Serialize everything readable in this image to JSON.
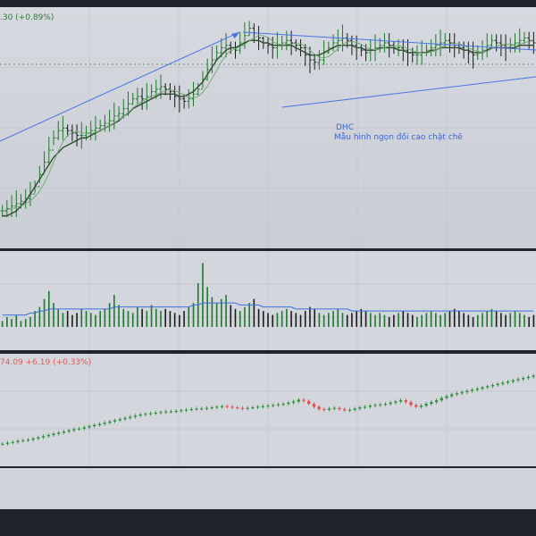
{
  "price_legend_text": ".30 (+0.89%)",
  "index_legend_text": "74.09 +6.19 (+0.33%)",
  "annotation": {
    "ticker": "DHC",
    "pattern": "Mẫu hình ngọn đồi cao chặt chẽ"
  },
  "colors": {
    "up": "#1e7a2a",
    "down": "#1c1c1c",
    "ma_long": "#2f4f2f",
    "ma_short": "#6aa86a",
    "trendline": "#4a73e8",
    "volume_ma": "#3b6fe0",
    "index_up": "#2e8b3a",
    "index_down": "#e04b4b"
  },
  "chart_data": [
    {
      "type": "ohlc",
      "panel": "price",
      "grid": true,
      "series": [
        {
          "name": "price",
          "values": [
            18.6,
            18.7,
            18.8,
            18.9,
            19.0,
            19.1,
            19.3,
            19.6,
            20.1,
            20.6,
            21.1,
            21.6,
            21.9,
            22.0,
            21.9,
            21.8,
            21.7,
            21.7,
            21.8,
            21.9,
            22.0,
            22.1,
            22.2,
            22.3,
            22.5,
            22.6,
            22.8,
            23.0,
            23.2,
            23.3,
            23.2,
            23.3,
            23.5,
            23.6,
            23.7,
            23.6,
            23.5,
            23.3,
            23.2,
            23.1,
            23.2,
            23.4,
            23.6,
            24.0,
            24.4,
            24.8,
            25.1,
            25.3,
            25.4,
            25.3,
            25.2,
            25.5,
            25.8,
            26.1,
            25.9,
            25.7,
            25.5,
            25.4,
            25.3,
            25.4,
            25.5,
            25.6,
            25.5,
            25.4,
            25.3,
            25.0,
            24.8,
            24.7,
            24.8,
            25.1,
            25.3,
            25.5,
            25.6,
            25.7,
            25.6,
            25.4,
            25.3,
            25.2,
            25.1,
            25.2,
            25.3,
            25.4,
            25.5,
            25.4,
            25.3,
            25.3,
            25.2,
            25.1,
            25.0,
            25.0,
            25.1,
            25.2,
            25.3,
            25.4,
            25.5,
            25.6,
            25.5,
            25.4,
            25.3,
            25.2,
            25.1,
            25.0,
            25.1,
            25.2,
            25.4,
            25.6,
            25.5,
            25.4,
            25.3,
            25.4,
            25.5,
            25.6,
            25.7,
            25.6,
            25.5
          ]
        },
        {
          "name": "ma_long",
          "values": [
            18.4,
            18.4,
            18.5,
            18.6,
            18.8,
            19.0,
            19.3,
            19.6,
            19.9,
            20.2,
            20.5,
            20.8,
            21.0,
            21.2,
            21.3,
            21.4,
            21.5,
            21.6,
            21.6,
            21.7,
            21.8,
            21.9,
            22.0,
            22.1,
            22.2,
            22.3,
            22.5,
            22.6,
            22.8,
            22.9,
            23.0,
            23.1,
            23.2,
            23.3,
            23.4,
            23.4,
            23.4,
            23.4,
            23.3,
            23.3,
            23.4,
            23.5,
            23.7,
            23.9,
            24.2,
            24.5,
            24.8,
            25.0,
            25.2,
            25.3,
            25.3,
            25.4,
            25.5,
            25.6,
            25.6,
            25.6,
            25.5,
            25.5,
            25.4,
            25.4,
            25.4,
            25.4,
            25.4,
            25.3,
            25.2,
            25.1,
            25.0,
            25.0,
            25.0,
            25.1,
            25.2,
            25.3,
            25.4,
            25.4,
            25.4,
            25.4,
            25.3,
            25.3,
            25.2,
            25.2,
            25.2,
            25.3,
            25.3,
            25.3,
            25.3,
            25.2,
            25.2,
            25.1,
            25.1,
            25.1,
            25.1,
            25.1,
            25.2,
            25.2,
            25.3,
            25.3,
            25.3,
            25.3,
            25.3,
            25.2,
            25.2,
            25.1,
            25.1,
            25.1,
            25.2,
            25.3,
            25.3,
            25.3,
            25.3,
            25.3,
            25.3,
            25.4,
            25.4,
            25.4,
            25.4
          ]
        }
      ]
    },
    {
      "type": "bar",
      "panel": "volume",
      "series": [
        {
          "name": "volume",
          "values": [
            3,
            5,
            4,
            6,
            3,
            4,
            5,
            8,
            10,
            14,
            18,
            12,
            9,
            7,
            8,
            6,
            7,
            9,
            8,
            7,
            6,
            8,
            9,
            12,
            16,
            11,
            9,
            8,
            7,
            10,
            9,
            8,
            11,
            9,
            8,
            9,
            8,
            7,
            6,
            8,
            10,
            12,
            22,
            32,
            20,
            15,
            12,
            14,
            16,
            11,
            9,
            8,
            10,
            12,
            14,
            9,
            8,
            7,
            6,
            7,
            8,
            9,
            8,
            7,
            6,
            8,
            10,
            9,
            7,
            6,
            7,
            8,
            9,
            7,
            6,
            7,
            8,
            9,
            8,
            7,
            6,
            7,
            6,
            5,
            6,
            7,
            8,
            7,
            6,
            5,
            6,
            7,
            8,
            7,
            6,
            7,
            8,
            9,
            8,
            7,
            6,
            5,
            6,
            7,
            8,
            9,
            8,
            7,
            6,
            7,
            8,
            7,
            6,
            5,
            6
          ]
        },
        {
          "name": "volume_ma",
          "values": [
            6,
            6,
            6,
            6,
            6,
            6,
            7,
            7,
            8,
            8,
            9,
            9,
            9,
            9,
            9,
            9,
            9,
            9,
            9,
            9,
            9,
            9,
            9,
            9,
            10,
            10,
            10,
            10,
            10,
            10,
            10,
            10,
            10,
            10,
            10,
            10,
            10,
            10,
            10,
            10,
            10,
            11,
            11,
            12,
            12,
            12,
            12,
            12,
            12,
            12,
            12,
            11,
            11,
            11,
            11,
            11,
            10,
            10,
            10,
            10,
            10,
            10,
            10,
            9,
            9,
            9,
            9,
            9,
            9,
            9,
            9,
            9,
            9,
            9,
            9,
            8,
            8,
            8,
            8,
            8,
            8,
            8,
            8,
            8,
            8,
            8,
            8,
            8,
            8,
            8,
            8,
            8,
            8,
            8,
            8,
            8,
            8,
            8,
            8,
            8,
            8,
            8,
            8,
            8,
            8,
            8,
            8,
            8,
            8,
            8,
            8,
            8,
            8,
            8,
            8
          ]
        }
      ]
    },
    {
      "type": "candlestick",
      "panel": "index",
      "series": [
        {
          "name": "index",
          "values": [
            1440,
            1442,
            1443,
            1445,
            1446,
            1447,
            1449,
            1451,
            1453,
            1455,
            1457,
            1459,
            1461,
            1463,
            1465,
            1466,
            1468,
            1470,
            1472,
            1474,
            1476,
            1478,
            1480,
            1482,
            1484,
            1486,
            1488,
            1490,
            1491,
            1492,
            1493,
            1494,
            1495,
            1495,
            1496,
            1497,
            1498,
            1499,
            1500,
            1500,
            1501,
            1502,
            1503,
            1504,
            1503,
            1502,
            1501,
            1500,
            1501,
            1502,
            1503,
            1504,
            1505,
            1506,
            1507,
            1508,
            1510,
            1512,
            1515,
            1513,
            1508,
            1503,
            1499,
            1498,
            1500,
            1501,
            1499,
            1497,
            1498,
            1500,
            1502,
            1503,
            1505,
            1506,
            1507,
            1508,
            1510,
            1512,
            1514,
            1511,
            1506,
            1503,
            1505,
            1508,
            1511,
            1514,
            1518,
            1521,
            1524,
            1526,
            1528,
            1530,
            1532,
            1534,
            1536,
            1538,
            1540,
            1542,
            1544,
            1546,
            1548,
            1550,
            1552,
            1554,
            1556
          ]
        }
      ]
    }
  ]
}
